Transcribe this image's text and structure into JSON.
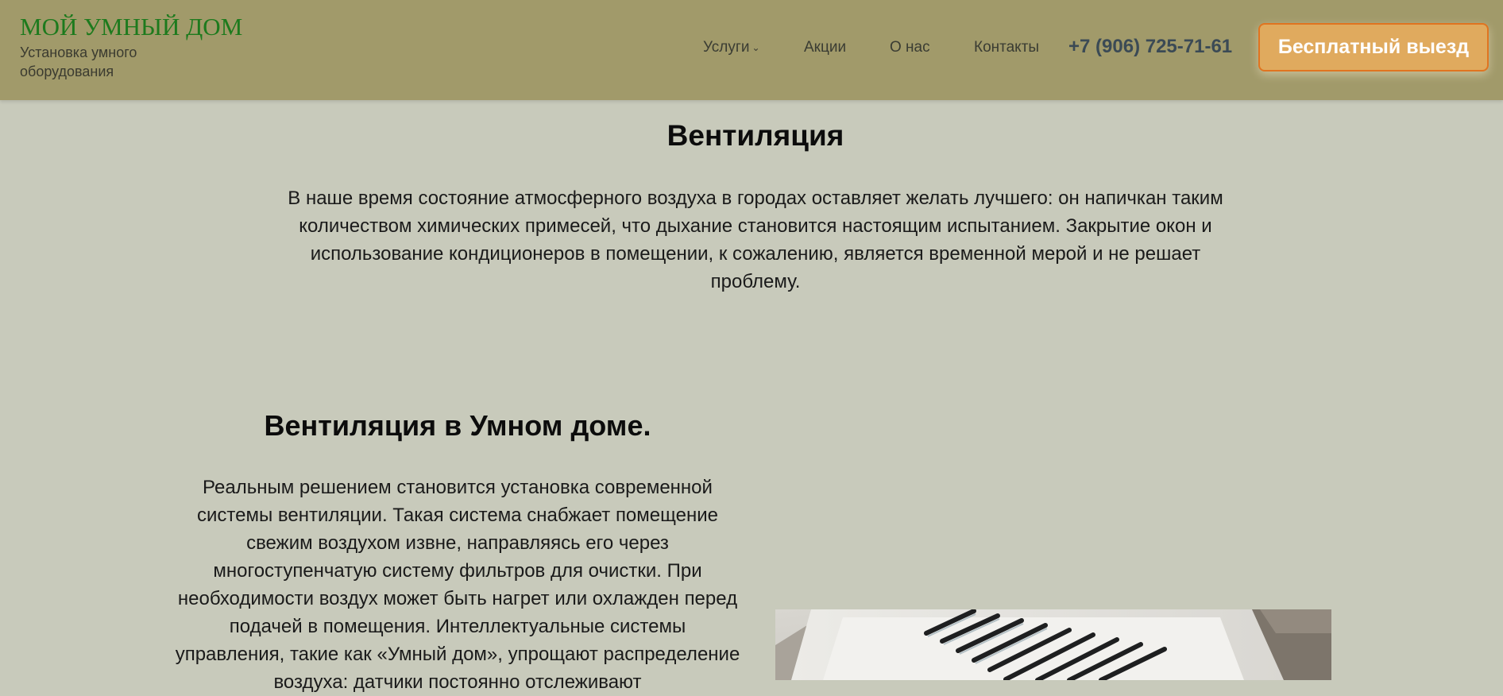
{
  "header": {
    "brand_title": "МОЙ УМНЫЙ ДОМ",
    "brand_subtitle": "Установка умного оборудования",
    "nav": [
      {
        "label": "Услуги",
        "has_dropdown": true
      },
      {
        "label": "Акции"
      },
      {
        "label": "О нас"
      },
      {
        "label": "Контакты"
      }
    ],
    "phone": "+7 (906) 725-71-61",
    "cta_label": "Бесплатный выезд"
  },
  "main": {
    "title": "Вентиляция",
    "intro": "В наше время состояние атмосферного воздуха в городах оставляет желать лучшего: он напичкан таким количеством химических примесей, что дыхание становится настоящим испытанием. Закрытие окон и использование кондиционеров в помещении, к сожалению, является временной мерой и не решает проблему.",
    "section_title": "Вентиляция в Умном доме.",
    "section_text": "Реальным решением становится установка современной системы вентиляции. Такая система снабжает помещение свежим воздухом извне, направляясь его через многоступенчатую систему фильтров для очистки. При необходимости воздух может быть нагрет или охлажден перед подачей в помещения. Интеллектуальные системы управления, такие как «Умный дом», упрощают распределение воздуха: датчики постоянно отслеживают"
  },
  "colors": {
    "header_bg": "#a19a6a",
    "page_bg": "#c8cabb",
    "brand_green": "#1d7a1d",
    "cta_bg": "#e0aa5e",
    "cta_border": "#e07420",
    "phone": "#3b4a55"
  },
  "icons": {
    "dropdown": "chevron-down-icon"
  }
}
